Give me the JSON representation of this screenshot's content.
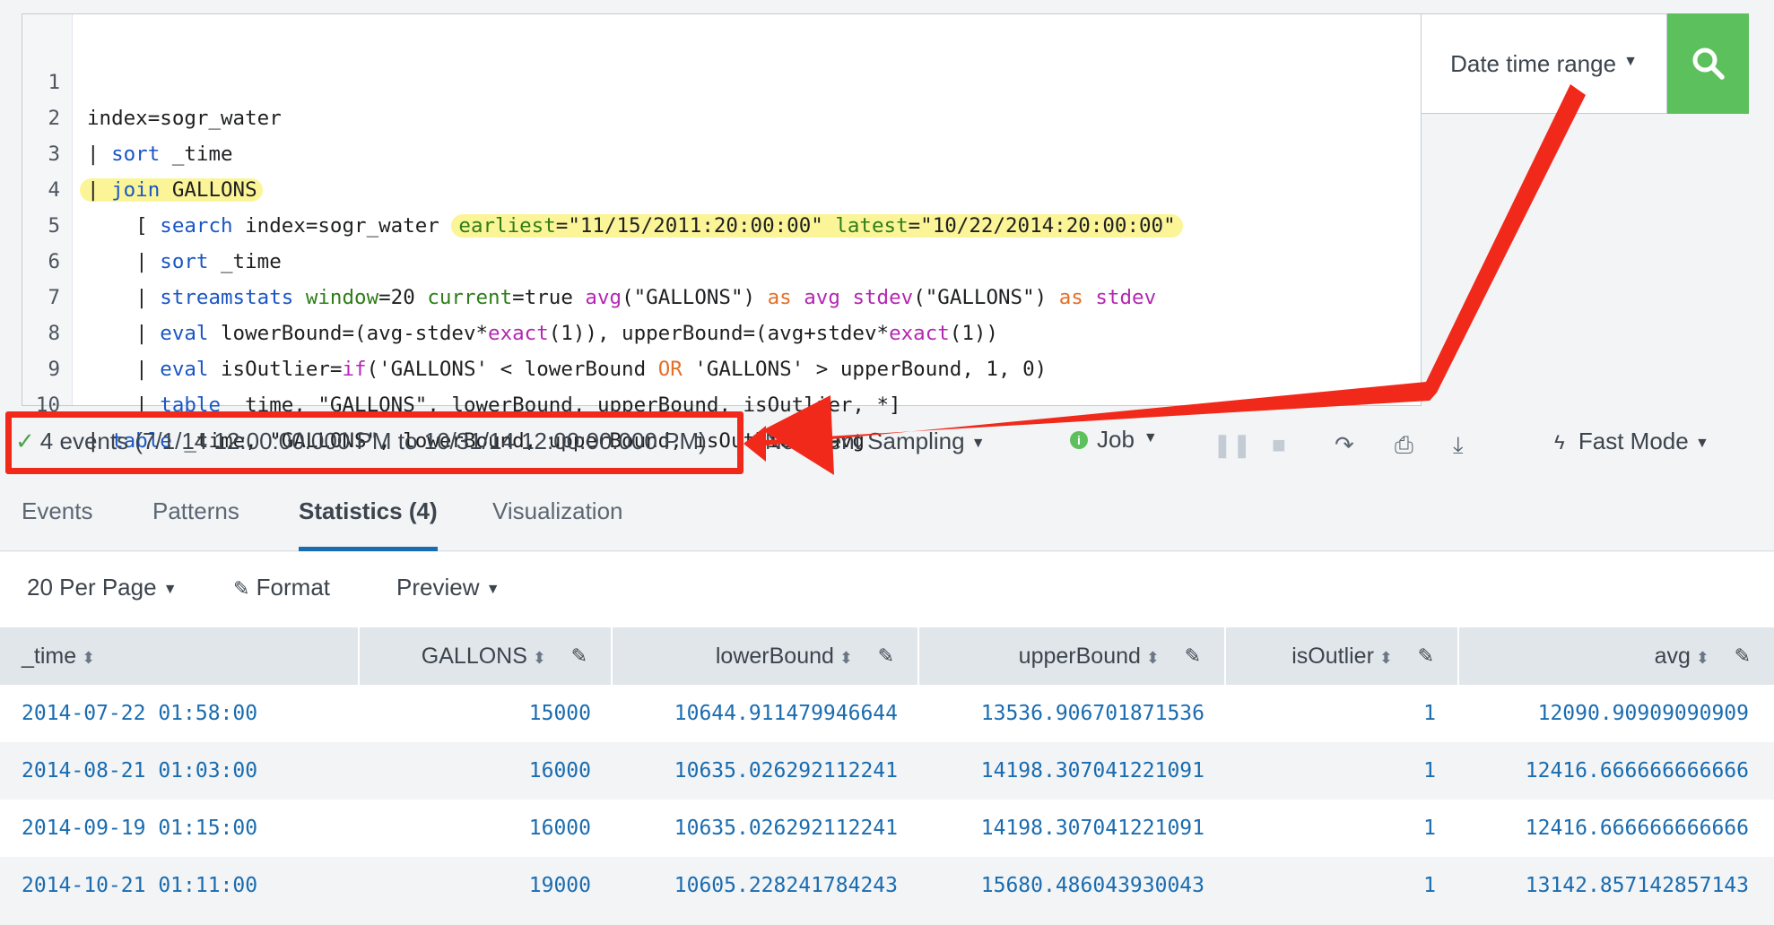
{
  "editor": {
    "lines": [
      {
        "num": "1"
      },
      {
        "num": "2"
      },
      {
        "num": "3"
      },
      {
        "num": "4"
      },
      {
        "num": "5"
      },
      {
        "num": "6"
      },
      {
        "num": "7"
      },
      {
        "num": "8"
      },
      {
        "num": "9"
      },
      {
        "num": "10"
      }
    ]
  },
  "date_range": {
    "label": "Date time range"
  },
  "status": {
    "events": "4 events (7/1/14 12:00:00.000 PM to 10/31/14 12:00:00.000 PM)",
    "sampling": "No Event Sampling",
    "job": "Job",
    "mode": "Fast Mode"
  },
  "tabs": [
    "Events",
    "Patterns",
    "Statistics (4)",
    "Visualization"
  ],
  "controls": {
    "per_page": "20 Per Page",
    "format": "Format",
    "preview": "Preview"
  },
  "table": {
    "columns": [
      "_time",
      "GALLONS",
      "lowerBound",
      "upperBound",
      "isOutlier",
      "avg"
    ],
    "rows": [
      [
        "2014-07-22 01:58:00",
        "15000",
        "10644.911479946644",
        "13536.906701871536",
        "1",
        "12090.90909090909"
      ],
      [
        "2014-08-21 01:03:00",
        "16000",
        "10635.026292112241",
        "14198.307041221091",
        "1",
        "12416.666666666666"
      ],
      [
        "2014-09-19 01:15:00",
        "16000",
        "10635.026292112241",
        "14198.307041221091",
        "1",
        "12416.666666666666"
      ],
      [
        "2014-10-21 01:11:00",
        "19000",
        "10605.228241784243",
        "15680.486043930043",
        "1",
        "13142.857142857143"
      ]
    ]
  },
  "colors": {
    "accent": "#1a6cb0",
    "search_button": "#5cc05c",
    "highlight": "#fbf597",
    "annotation": "#f1291a"
  }
}
